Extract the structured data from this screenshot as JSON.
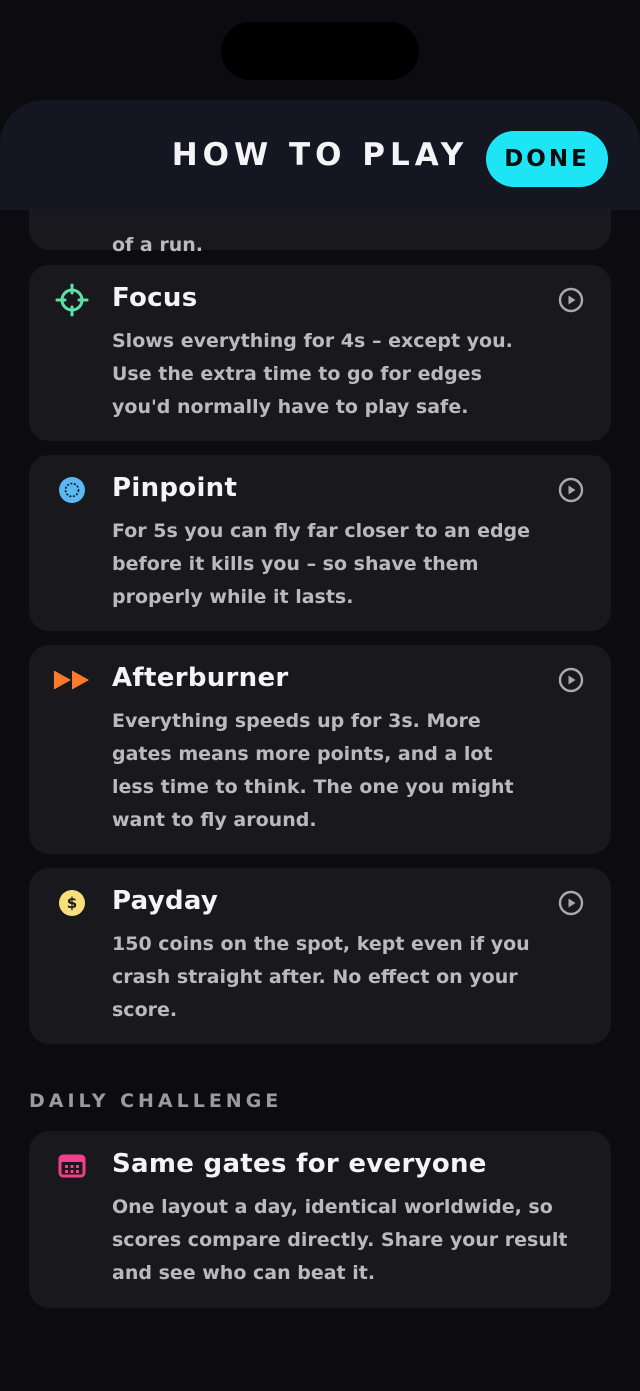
{
  "header": {
    "title": "HOW TO PLAY",
    "done_label": "DONE"
  },
  "colors": {
    "accent": "#1ee5f5",
    "focus_icon": "#5fe0a8",
    "pinpoint_icon": "#5bb8f0",
    "afterburner_icon": "#ff7a2a",
    "payday_icon": "#f7e07a",
    "calendar_icon": "#f0408a"
  },
  "partial_card": {
    "text": "of a run."
  },
  "powerups": [
    {
      "icon": "crosshair-icon",
      "title": "Focus",
      "body": "Slows everything for 4s – except you. Use the extra time to go for edges you'd normally have to play safe."
    },
    {
      "icon": "target-dot-icon",
      "title": "Pinpoint",
      "body": "For 5s you can fly far closer to an edge before it kills you – so shave them properly while it lasts."
    },
    {
      "icon": "fast-forward-icon",
      "title": "Afterburner",
      "body": "Everything speeds up for 3s. More gates means more points, and a lot less time to think. The one you might want to fly around."
    },
    {
      "icon": "coin-icon",
      "coin_symbol": "$",
      "title": "Payday",
      "body": "150 coins on the spot, kept even if you crash straight after. No effect on your score."
    }
  ],
  "daily": {
    "section_label": "DAILY CHALLENGE",
    "icon": "calendar-icon",
    "title": "Same gates for everyone",
    "body": "One layout a day, identical worldwide, so scores compare directly. Share your result and see who can beat it."
  }
}
